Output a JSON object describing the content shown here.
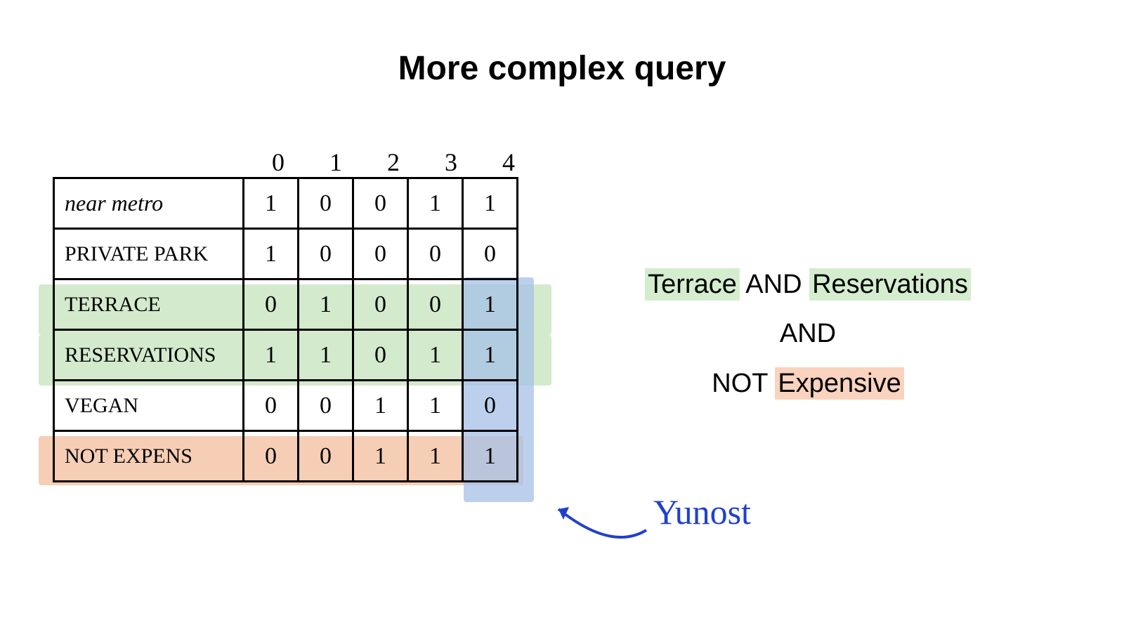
{
  "title": "More complex query",
  "chart_data": {
    "type": "table",
    "title": "More complex query",
    "columns": [
      "0",
      "1",
      "2",
      "3",
      "4"
    ],
    "rows": [
      {
        "label": "near metro",
        "values": [
          1,
          0,
          0,
          1,
          1
        ],
        "highlight": null
      },
      {
        "label": "PRIVATE PARK",
        "values": [
          1,
          0,
          0,
          0,
          0
        ],
        "highlight": null
      },
      {
        "label": "TERRACE",
        "values": [
          0,
          1,
          0,
          0,
          1
        ],
        "highlight": "green"
      },
      {
        "label": "RESERVATIONS",
        "values": [
          1,
          1,
          0,
          1,
          1
        ],
        "highlight": "green"
      },
      {
        "label": "VEGAN",
        "values": [
          0,
          0,
          1,
          1,
          0
        ],
        "highlight": null
      },
      {
        "label": "NOT EXPENS",
        "values": [
          0,
          0,
          1,
          1,
          1
        ],
        "highlight": "orange"
      }
    ],
    "result_column": "4",
    "query_text": "Terrace AND Reservations AND NOT Expensive",
    "result_label": "Yunost"
  },
  "query": {
    "line1_prefix": "Terrace",
    "line1_mid": " AND ",
    "line1_suffix": "Reservations",
    "line2": "AND",
    "line3_prefix": "NOT ",
    "line3_suffix": "Expensive"
  },
  "annotation": "Yunost"
}
